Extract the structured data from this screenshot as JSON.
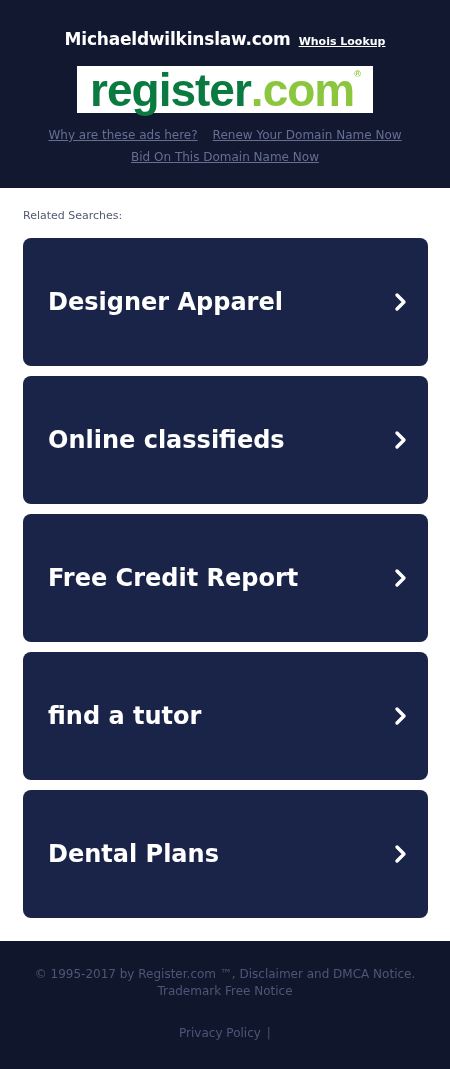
{
  "header": {
    "domain": "Michaeldwilkinslaw.com",
    "whois_link": "Whois Lookup",
    "logo": {
      "name": "register",
      "suffix": ".com",
      "mark": "®"
    },
    "links": [
      "Why are these ads here?",
      "Renew Your Domain Name Now",
      "Bid On This Domain Name Now"
    ]
  },
  "related": {
    "label": "Related Searches:",
    "items": [
      {
        "text": "Designer Apparel"
      },
      {
        "text": "Online classifieds"
      },
      {
        "text": "Free Credit Report"
      },
      {
        "text": "find a tutor"
      },
      {
        "text": "Dental Plans"
      }
    ]
  },
  "footer": {
    "notice": "© 1995-2017 by Register.com ™, Disclaimer and DMCA Notice. Trademark Free Notice",
    "links": [
      "Privacy Policy"
    ],
    "separator": "|"
  }
}
